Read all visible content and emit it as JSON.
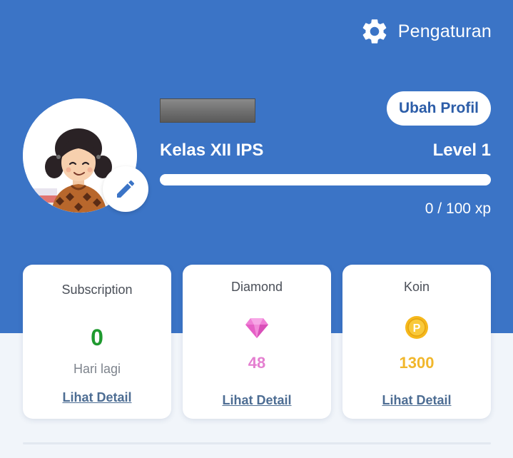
{
  "header": {
    "settings_label": "Pengaturan",
    "settings_icon": "gear-icon"
  },
  "profile": {
    "avatar_icon": "avatar-girl",
    "edit_icon": "pencil-icon",
    "edit_profile_label": "Ubah Profil",
    "class_label": "Kelas XII IPS",
    "level_label": "Level 1",
    "xp_current": 0,
    "xp_max": 100,
    "xp_label": "0 / 100 xp"
  },
  "cards": {
    "subscription": {
      "title": "Subscription",
      "value": "0",
      "sub": "Hari lagi",
      "link": "Lihat Detail",
      "value_color": "#1f9a2f"
    },
    "diamond": {
      "title": "Diamond",
      "value": "48",
      "link": "Lihat Detail",
      "icon": "diamond-icon",
      "value_color": "#e47fd0"
    },
    "koin": {
      "title": "Koin",
      "value": "1300",
      "link": "Lihat Detail",
      "icon": "coin-icon",
      "coin_glyph": "P",
      "value_color": "#f1b72c"
    }
  },
  "colors": {
    "primary": "#3b74c6",
    "link": "#4d6d93",
    "button_text": "#2c5da8"
  }
}
